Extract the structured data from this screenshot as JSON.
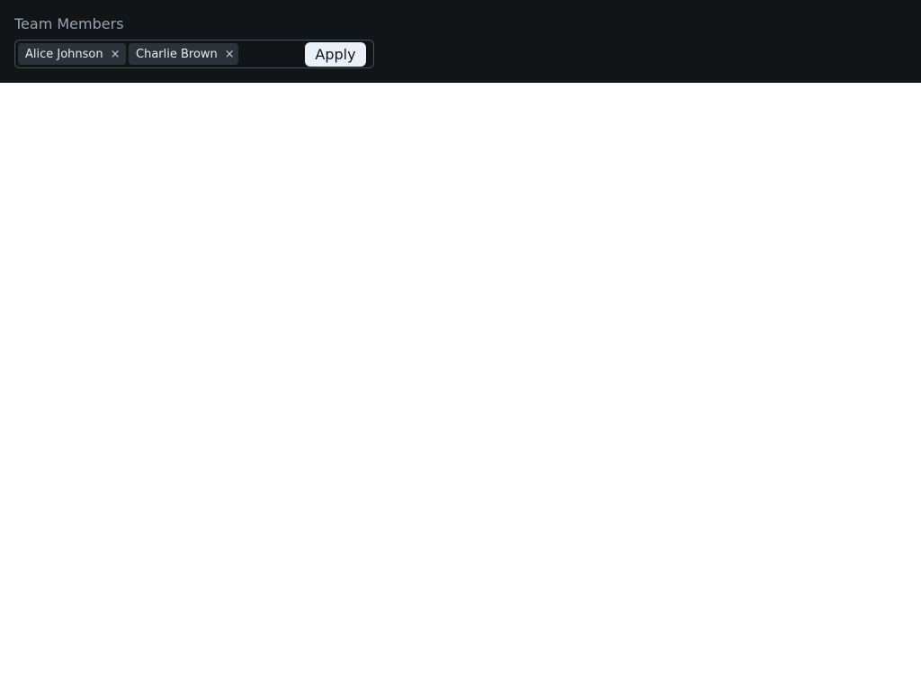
{
  "field": {
    "label": "Team Members",
    "input_value": "",
    "input_placeholder": ""
  },
  "chips": [
    {
      "label": "Alice Johnson",
      "remove_glyph": "×",
      "remove_icon": "close-icon"
    },
    {
      "label": "Charlie Brown",
      "remove_glyph": "×",
      "remove_icon": "close-icon"
    }
  ],
  "actions": {
    "apply_label": "Apply"
  },
  "colors": {
    "panel_background": "#111518",
    "chip_background": "#2c3237",
    "button_background": "#e9f1f7",
    "label_text": "#9aa3ad"
  }
}
